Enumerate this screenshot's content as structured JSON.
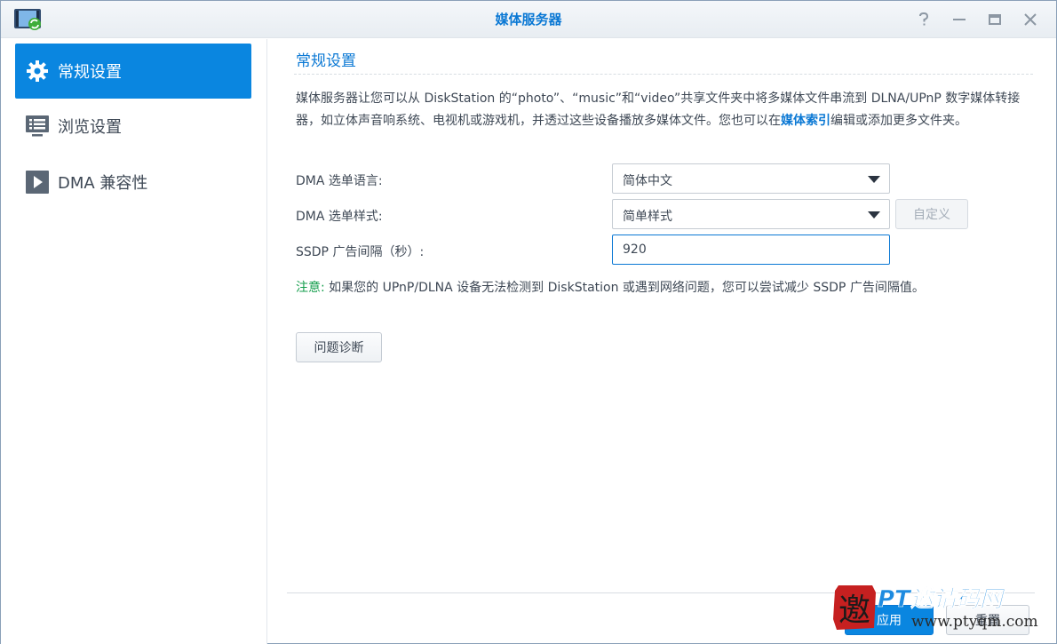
{
  "window": {
    "title": "媒体服务器"
  },
  "sidebar": {
    "items": [
      {
        "label": "常规设置",
        "icon": "gear-icon",
        "active": true
      },
      {
        "label": "浏览设置",
        "icon": "browse-list-icon",
        "active": false
      },
      {
        "label": "DMA 兼容性",
        "icon": "play-icon",
        "active": false
      }
    ]
  },
  "main": {
    "section_title": "常规设置",
    "description_before": "媒体服务器让您可以从 DiskStation 的“photo”、“music”和“video”共享文件夹中将多媒体文件串流到 DLNA/UPnP 数字媒体转接器，如立体声音响系统、电视机或游戏机，并透过这些设备播放多媒体文件。您也可以在",
    "description_link": "媒体索引",
    "description_after": "编辑或添加更多文件夹。",
    "fields": {
      "menu_language": {
        "label": "DMA 选单语言:",
        "value": "简体中文"
      },
      "menu_style": {
        "label": "DMA 选单样式:",
        "value": "简单样式"
      },
      "ssdp_interval": {
        "label": "SSDP 广告间隔（秒）:",
        "value": "920"
      }
    },
    "custom_button": "自定义",
    "note_label": "注意:",
    "note_text": " 如果您的 UPnP/DLNA 设备无法检测到 DiskStation 或遇到网络问题，您可以尝试减少 SSDP 广告间隔值。",
    "diagnose_button": "问题诊断"
  },
  "footer": {
    "apply_button": "应用",
    "reset_button": "重置"
  },
  "watermark": {
    "brand": "PT邀请码网",
    "url": "www.ptyqm.com",
    "seal_char": "邀"
  },
  "colors": {
    "accent": "#0a86e0",
    "title_blue": "#0a78d4",
    "note_green": "#159e4d"
  }
}
